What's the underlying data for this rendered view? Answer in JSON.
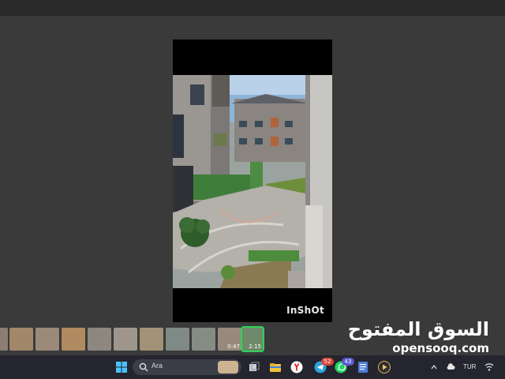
{
  "video": {
    "watermark": "InShOt"
  },
  "filmstrip": {
    "thumbs": [
      {
        "duration": ""
      },
      {
        "duration": ""
      },
      {
        "duration": ""
      },
      {
        "duration": ""
      },
      {
        "duration": ""
      },
      {
        "duration": ""
      },
      {
        "duration": ""
      },
      {
        "duration": ""
      },
      {
        "duration": ""
      },
      {
        "duration": "0:47"
      },
      {
        "duration": "2:15",
        "active": true
      }
    ]
  },
  "brand": {
    "arabic": "السوق المفتوح",
    "latin": "opensooq.com"
  },
  "taskbar": {
    "search_placeholder": "Ara",
    "badges": {
      "telegram": "52",
      "whatsapp": "43"
    },
    "tray": {
      "language": "TUR"
    },
    "icons": [
      "windows-start-icon",
      "search-icon",
      "task-view-icon",
      "file-explorer-icon",
      "yandex-icon",
      "telegram-icon",
      "whatsapp-icon",
      "notepad-icon",
      "media-player-icon"
    ]
  }
}
